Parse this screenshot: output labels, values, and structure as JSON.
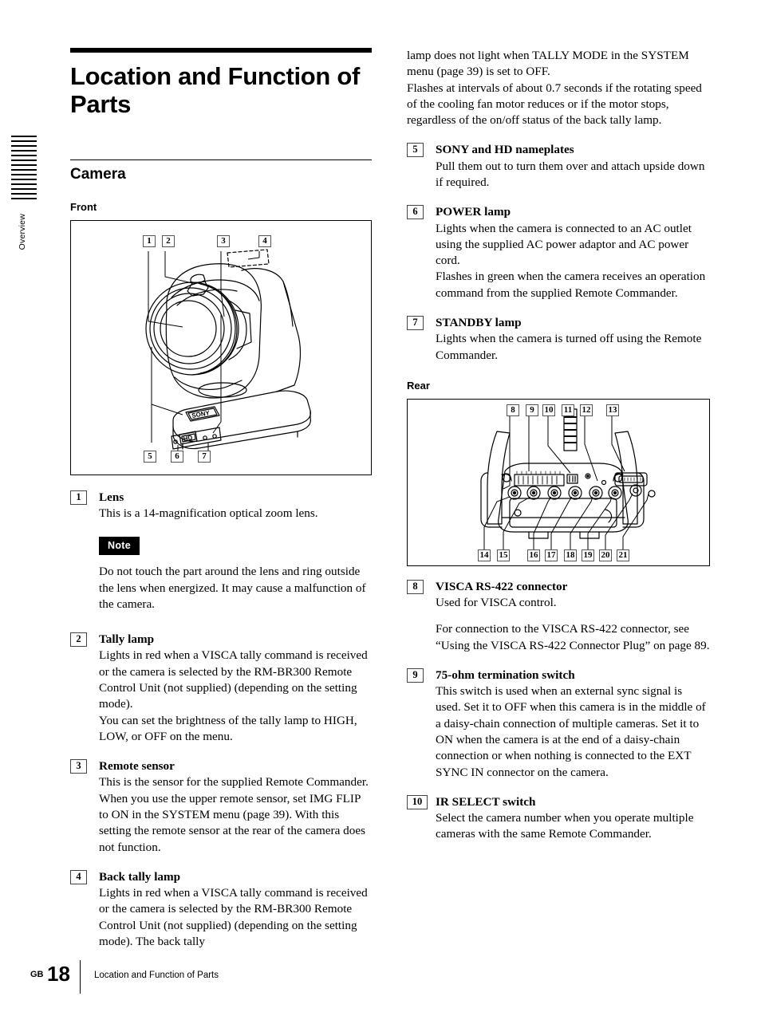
{
  "side_tab": {
    "label": "Overview",
    "bar_count": 14
  },
  "header": {
    "title": "Location and Function of Parts",
    "section": "Camera",
    "sub_front": "Front",
    "sub_rear": "Rear"
  },
  "note": {
    "badge": "Note",
    "body": "Do not touch the part around the lens and ring outside the lens when energized. It may cause a malfunction of the camera."
  },
  "figures": {
    "front": {
      "name": "camera-front-illustration",
      "top_callouts": [
        "1",
        "2",
        "3",
        "4"
      ],
      "bottom_callouts": [
        "5",
        "6",
        "7"
      ],
      "nameplate_sony": "SONY",
      "nameplate_hd": "HD"
    },
    "rear": {
      "name": "camera-rear-illustration",
      "top_callouts": [
        "8",
        "9",
        "10",
        "11",
        "12",
        "13"
      ],
      "bottom_callouts": [
        "14",
        "15",
        "16",
        "17",
        "18",
        "19",
        "20",
        "21"
      ]
    }
  },
  "items_left": [
    {
      "num": "1",
      "label": "Lens",
      "paras": [
        "This is a 14-magnification optical zoom lens."
      ]
    },
    {
      "num": "2",
      "label": "Tally lamp",
      "paras": [
        "Lights in red when a VISCA tally command is received or the camera is selected by the RM-BR300 Remote Control Unit (not supplied) (depending on the setting mode).",
        "You can set the brightness of the tally lamp to HIGH, LOW, or OFF on the menu."
      ]
    },
    {
      "num": "3",
      "label": "Remote sensor",
      "paras": [
        "This is the sensor for the supplied Remote Commander.",
        "When you use the upper remote sensor, set IMG FLIP to ON in the SYSTEM menu (page 39). With this setting the remote sensor at the rear of the camera does not function."
      ]
    },
    {
      "num": "4",
      "label": "Back tally lamp",
      "paras": [
        "Lights in red when a VISCA tally command is received or the camera is selected by the RM-BR300 Remote Control Unit (not supplied) (depending on the setting mode). The back tally"
      ]
    }
  ],
  "continuation_right": [
    "lamp does not light when TALLY MODE in the SYSTEM menu (page 39) is set to OFF.",
    "Flashes at intervals of about 0.7 seconds if the rotating speed of the cooling fan motor reduces or if the motor stops, regardless of the on/off status of the back tally lamp."
  ],
  "items_right_top": [
    {
      "num": "5",
      "label": "SONY and HD nameplates",
      "paras": [
        "Pull them out to turn them over and attach upside down if required."
      ]
    },
    {
      "num": "6",
      "label": "POWER lamp",
      "paras": [
        "Lights when the camera is connected to an AC outlet using the supplied AC power adaptor and AC power cord.",
        "Flashes in green when the camera receives an operation command from the supplied Remote Commander."
      ]
    },
    {
      "num": "7",
      "label": "STANDBY lamp",
      "paras": [
        "Lights when the camera is turned off using the Remote Commander."
      ]
    }
  ],
  "items_right_bottom": [
    {
      "num": "8",
      "label": "VISCA RS-422 connector",
      "paras": [
        "Used for VISCA control."
      ],
      "spaced_paras": [
        "For connection to the VISCA RS-422 connector, see “Using the VISCA RS-422 Connector Plug” on page 89."
      ]
    },
    {
      "num": "9",
      "label": "75-ohm termination switch",
      "paras": [
        "This switch is used when an external sync signal is used. Set it to OFF when this camera is in the middle of a daisy-chain connection of multiple cameras. Set it to ON when the camera is at the end of a daisy-chain connection or when nothing is connected to the EXT SYNC IN connector on the camera."
      ]
    },
    {
      "num": "10",
      "label": "IR SELECT switch",
      "paras": [
        "Select the camera number when you operate multiple cameras with the same Remote Commander."
      ]
    }
  ],
  "footer": {
    "region": "GB",
    "page_number": "18",
    "breadcrumb": "Location and Function of Parts"
  }
}
